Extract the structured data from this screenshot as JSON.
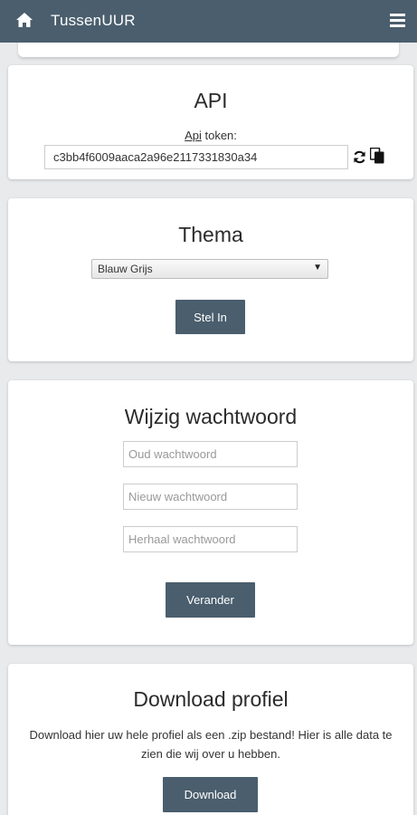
{
  "header": {
    "title": "TussenUUR",
    "home_icon": "home-icon",
    "menu_icon": "hamburger-menu-icon",
    "background": "#4a5e6d"
  },
  "api": {
    "title": "API",
    "label_underlined": "Api",
    "label_rest": " token:",
    "token": "c3bb4f6009aaca2a96e2117331830a34",
    "refresh_icon": "refresh-icon",
    "copy_icon": "copy-icon"
  },
  "theme": {
    "title": "Thema",
    "selected": "Blauw Grijs",
    "button": "Stel In"
  },
  "password": {
    "title": "Wijzig wachtwoord",
    "old_placeholder": "Oud wachtwoord",
    "new_placeholder": "Nieuw wachtwoord",
    "repeat_placeholder": "Herhaal wachtwoord",
    "button": "Verander"
  },
  "download": {
    "title": "Download profiel",
    "description": "Download hier uw hele profiel als een .zip bestand! Hier is alle data te zien die wij over u hebben.",
    "button": "Download"
  }
}
